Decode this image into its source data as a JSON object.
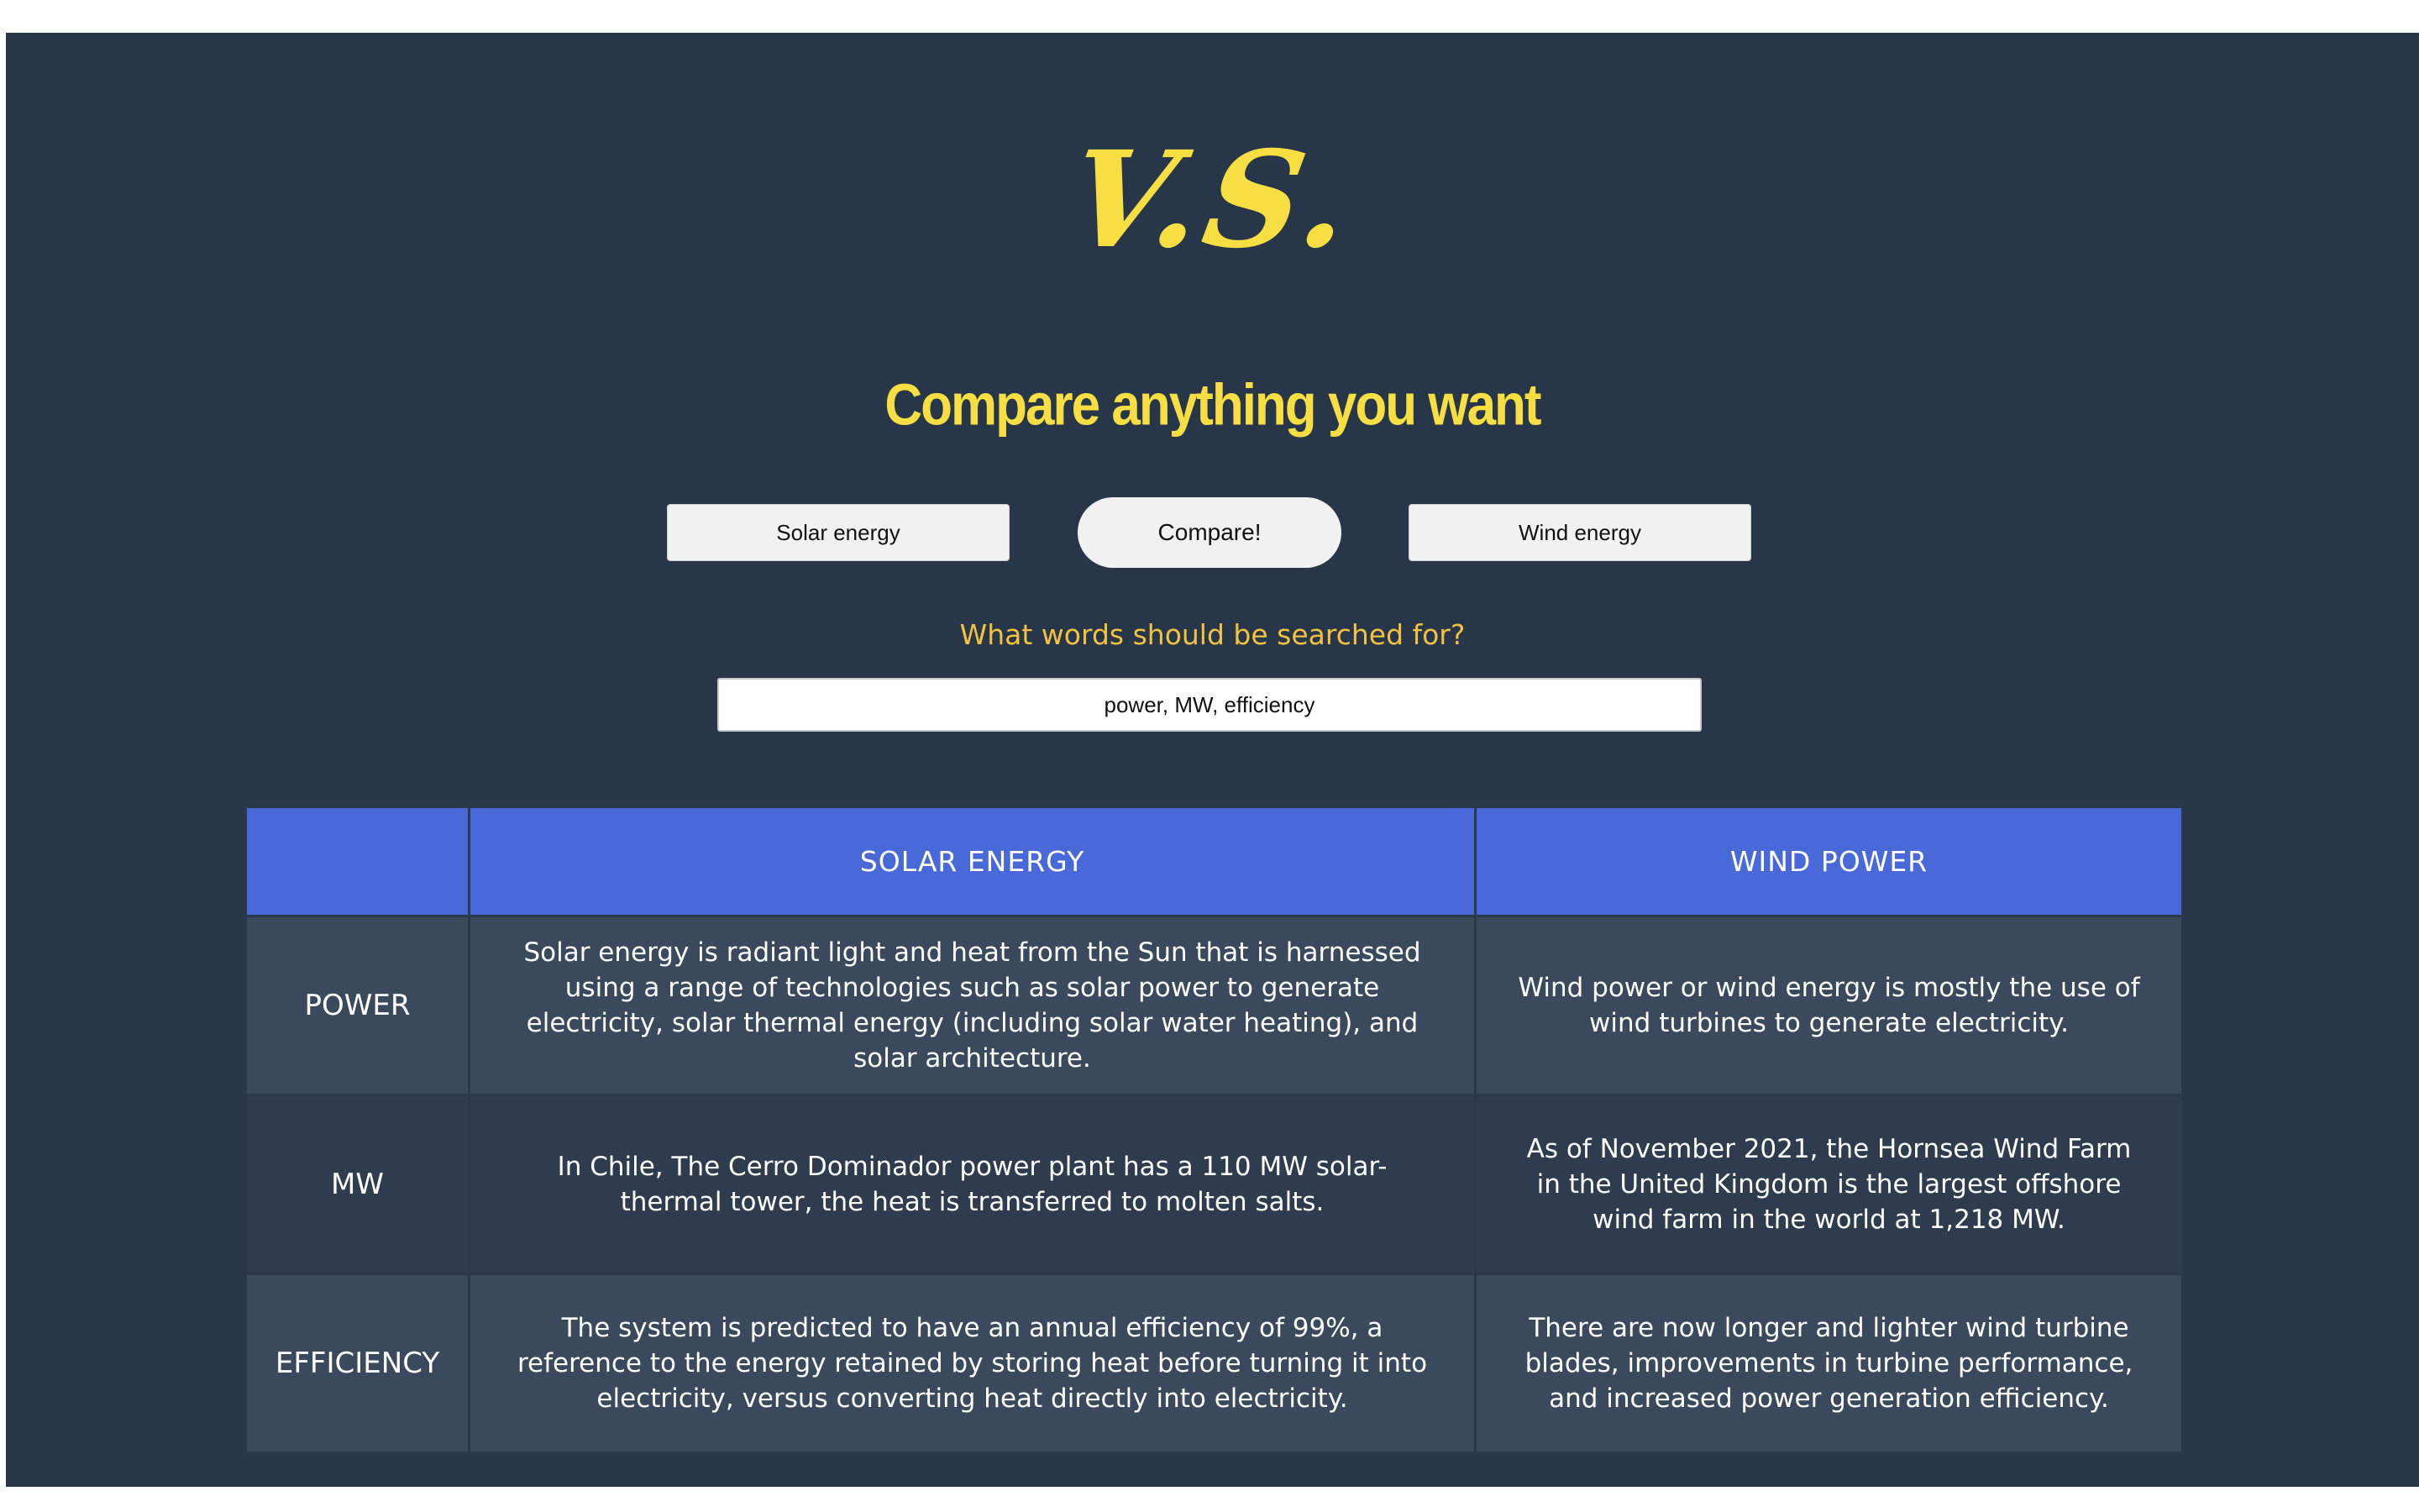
{
  "header": {
    "logo_text": "V.S.",
    "tagline": "Compare anything you want"
  },
  "form": {
    "topic_a_value": "Solar energy",
    "compare_label": "Compare!",
    "topic_b_value": "Wind energy",
    "question": "What words should be searched for?",
    "words_value": "power, MW, efficiency"
  },
  "table": {
    "headers": [
      "",
      "SOLAR ENERGY",
      "WIND POWER"
    ],
    "rows": [
      {
        "label": "POWER",
        "a": "Solar energy is radiant light and heat from the Sun that is harnessed using a range of technologies such as solar power to generate electricity, solar thermal energy (including solar water heating), and solar architecture.",
        "b": "Wind power or wind energy is mostly the use of wind turbines to generate electricity."
      },
      {
        "label": "MW",
        "a": "In Chile, The Cerro Dominador power plant has a 110 MW solar-thermal tower, the heat is transferred to molten salts.",
        "b": "As of November 2021, the Hornsea Wind Farm in the United Kingdom is the largest offshore wind farm in the world at 1,218 MW."
      },
      {
        "label": "EFFICIENCY",
        "a": "The system is predicted to have an annual efficiency of 99%, a reference to the energy retained by storing heat before turning it into electricity, versus converting heat directly into electricity.",
        "b": "There are now longer and lighter wind turbine blades, improvements in turbine performance, and increased power generation efficiency."
      }
    ]
  },
  "colors": {
    "background": "#283649",
    "accent_yellow": "#f6de43",
    "question_yellow": "#f2c240",
    "table_header": "#4a69d9"
  }
}
